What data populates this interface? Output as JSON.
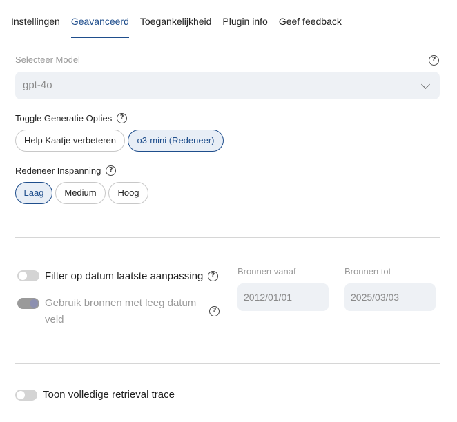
{
  "tabs": [
    {
      "label": "Instellingen",
      "active": false
    },
    {
      "label": "Geavanceerd",
      "active": true
    },
    {
      "label": "Toegankelijkheid",
      "active": false
    },
    {
      "label": "Plugin info",
      "active": false
    },
    {
      "label": "Geef feedback",
      "active": false
    }
  ],
  "model": {
    "label": "Selecteer Model",
    "value": "gpt-4o",
    "help_icon": "question-circle-icon"
  },
  "generation": {
    "label": "Toggle Generatie Opties",
    "options": [
      {
        "label": "Help Kaatje verbeteren",
        "selected": false
      },
      {
        "label": "o3-mini (Redeneer)",
        "selected": true
      }
    ]
  },
  "reasoning": {
    "label": "Redeneer Inspanning",
    "options": [
      {
        "label": "Laag",
        "selected": true
      },
      {
        "label": "Medium",
        "selected": false
      },
      {
        "label": "Hoog",
        "selected": false
      }
    ]
  },
  "filters": {
    "date_filter_label": "Filter op datum laatste aanpassing",
    "date_filter_on": false,
    "empty_date_label": "Gebruik bronnen met leeg datum veld",
    "empty_date_on": true,
    "from_label": "Bronnen vanaf",
    "from_value": "2012/01/01",
    "to_label": "Bronnen tot",
    "to_value": "2025/03/03"
  },
  "trace": {
    "label": "Toon volledige retrieval trace",
    "on": false
  },
  "colors": {
    "accent": "#1f4e8c",
    "selected_bg": "#e8eef6",
    "input_bg": "#eef1f5"
  },
  "help_text": "?"
}
